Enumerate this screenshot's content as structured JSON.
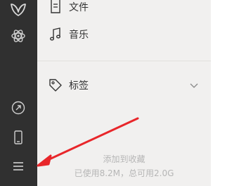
{
  "sidebar": {
    "icons": [
      "butterfly-logo-icon",
      "atom-icon",
      "link-circle-icon",
      "phone-icon",
      "menu-icon"
    ]
  },
  "nav": {
    "items": [
      {
        "label": "文件",
        "icon": "document-icon"
      },
      {
        "label": "音乐",
        "icon": "music-note-icon"
      },
      {
        "label": "标签",
        "icon": "tag-icon"
      }
    ]
  },
  "storage": {
    "action": "添加到收藏",
    "usage": "已使用8.2M，总可用2.0G"
  },
  "colors": {
    "sidebar_bg": "#303030",
    "panel_bg": "#f1f0ef",
    "annotation_arrow": "#e8262a"
  }
}
